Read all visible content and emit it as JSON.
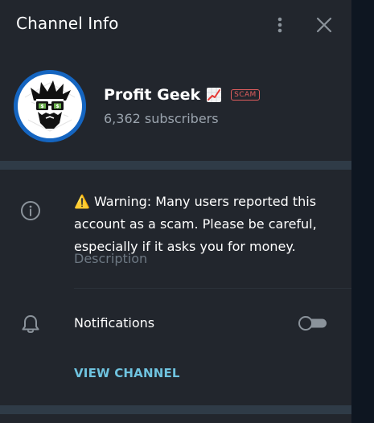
{
  "header": {
    "title": "Channel Info",
    "more_icon": "more-vertical-icon",
    "close_icon": "close-icon"
  },
  "profile": {
    "name": "Profit Geek",
    "emoji": "📈",
    "badge": "SCAM",
    "subscribers": "6,362 subscribers",
    "avatar_color": "#1565c0"
  },
  "description": {
    "icon": "info-icon",
    "text": "⚠️ Warning: Many users reported this account as a scam. Please be careful, especially if it asks you for money.",
    "label": "Description"
  },
  "notifications": {
    "icon": "bell-icon",
    "label": "Notifications",
    "enabled": false
  },
  "actions": {
    "view_channel": "VIEW CHANNEL"
  },
  "colors": {
    "panel_bg": "#22262d",
    "divider": "#2f3b47",
    "accent": "#6fc3df",
    "scam_red": "#e05d5d"
  }
}
